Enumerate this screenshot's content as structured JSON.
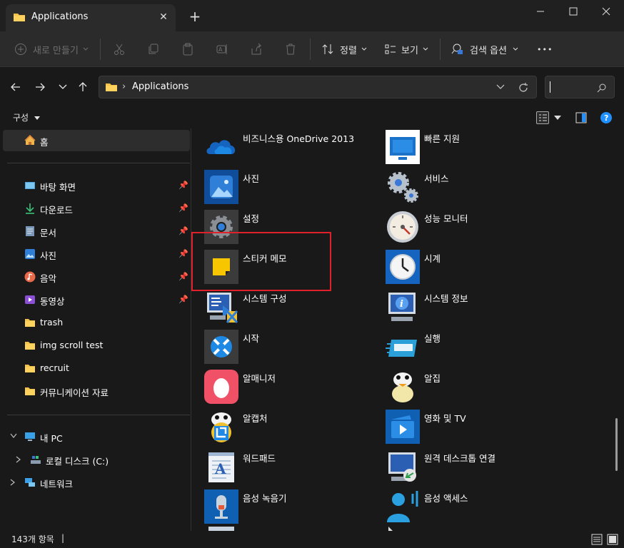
{
  "window": {
    "tab_title": "Applications",
    "new_tab_glyph": "+",
    "tab_close_glyph": "✕"
  },
  "toolbar": {
    "new_label": "새로 만들기",
    "sort_label": "정렬",
    "view_label": "보기",
    "search_options_label": "검색 옵션",
    "more_glyph": "•••"
  },
  "address": {
    "path_label": "Applications",
    "separator": "›"
  },
  "organize_label": "구성",
  "sidebar": {
    "home": "홈",
    "quick_access": [
      {
        "label": "바탕 화면",
        "icon": "desktop-icon",
        "pinned": true
      },
      {
        "label": "다운로드",
        "icon": "download-icon",
        "pinned": true
      },
      {
        "label": "문서",
        "icon": "document-icon",
        "pinned": true
      },
      {
        "label": "사진",
        "icon": "pictures-icon",
        "pinned": true
      },
      {
        "label": "음악",
        "icon": "music-icon",
        "pinned": true
      },
      {
        "label": "동영상",
        "icon": "videos-icon",
        "pinned": true
      },
      {
        "label": "trash",
        "icon": "folder-icon",
        "pinned": false
      },
      {
        "label": "img scroll test",
        "icon": "folder-icon",
        "pinned": false
      },
      {
        "label": "recruit",
        "icon": "folder-icon",
        "pinned": false
      },
      {
        "label": "커뮤니케이션 자료",
        "icon": "folder-icon",
        "pinned": false
      }
    ],
    "this_pc": "내 PC",
    "local_disk": "로컬 디스크 (C:)",
    "network": "네트워크"
  },
  "apps": [
    {
      "label": "비즈니스용 OneDrive 2013",
      "icon": "onedrive-cloud-icon"
    },
    {
      "label": "빠른 지원",
      "icon": "quick-assist-icon"
    },
    {
      "label": "사진",
      "icon": "photos-app-icon"
    },
    {
      "label": "서비스",
      "icon": "services-gears-icon"
    },
    {
      "label": "설정",
      "icon": "settings-gear-icon"
    },
    {
      "label": "성능 모니터",
      "icon": "performance-monitor-icon"
    },
    {
      "label": "스티커 메모",
      "icon": "sticky-notes-icon"
    },
    {
      "label": "시계",
      "icon": "clock-icon"
    },
    {
      "label": "시스템 구성",
      "icon": "system-config-icon"
    },
    {
      "label": "시스템 정보",
      "icon": "system-info-icon"
    },
    {
      "label": "시작",
      "icon": "tips-start-icon"
    },
    {
      "label": "실행",
      "icon": "run-icon"
    },
    {
      "label": "알매니저",
      "icon": "almanager-egg-icon"
    },
    {
      "label": "알집",
      "icon": "alzip-icon"
    },
    {
      "label": "알캡처",
      "icon": "alcapture-icon"
    },
    {
      "label": "영화 및 TV",
      "icon": "movies-tv-icon"
    },
    {
      "label": "워드패드",
      "icon": "wordpad-icon"
    },
    {
      "label": "원격 데스크톱 연결",
      "icon": "remote-desktop-icon"
    },
    {
      "label": "음성 녹음기",
      "icon": "voice-recorder-icon"
    },
    {
      "label": "음성 액세스",
      "icon": "voice-access-icon"
    }
  ],
  "status": {
    "item_count": "143개 항목",
    "cursor_glyph": "|"
  },
  "colors": {
    "background": "#191919",
    "toolbar": "#2b2b2b",
    "folder_yellow": "#f4c14b",
    "selection_highlight": "#e0202a",
    "accent_blue": "#1e90ff"
  }
}
